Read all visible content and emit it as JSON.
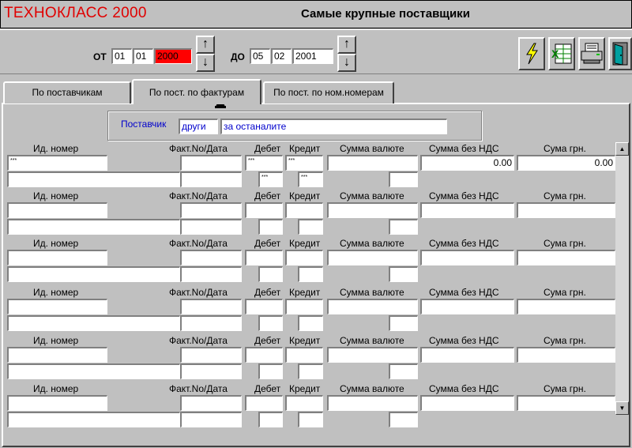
{
  "app": {
    "title": "ТЕХНОКЛАСС 2000",
    "window_title": "Самые крупные поставщики"
  },
  "date_from": {
    "label": "ОТ",
    "day": "01",
    "month": "01",
    "year": "2000"
  },
  "date_to": {
    "label": "ДО",
    "day": "05",
    "month": "02",
    "year": "2001"
  },
  "spinner": {
    "up": "↑",
    "down": "↓"
  },
  "toolbar": {
    "buttons": [
      {
        "name": "run",
        "icon": "lightning-icon"
      },
      {
        "name": "excel-export",
        "icon": "excel-icon"
      },
      {
        "name": "print",
        "icon": "printer-icon"
      },
      {
        "name": "exit",
        "icon": "exit-door-icon"
      }
    ]
  },
  "tabs": [
    {
      "label": "По поставчикам",
      "active": false
    },
    {
      "label": "По пост. по фактурам",
      "active": true
    },
    {
      "label": "По пост. по ном.номерам",
      "active": false
    }
  ],
  "supplier": {
    "label": "Поставчик",
    "code": "други",
    "name": "за останалите"
  },
  "columns": {
    "id": "Ид. номер",
    "invoice": "Факт.No/Дата",
    "debit": "Дебет",
    "credit": "Кредит",
    "currency_sum": "Сумма валюте",
    "sum_no_vat": "Сумма без НДС",
    "sum_uah": "Сума грн."
  },
  "first_row": {
    "id": "***",
    "debit": "***",
    "credit": "***",
    "debit2": "***",
    "credit2": "***",
    "sum_no_vat": "0.00",
    "sum_uah": "0.00"
  },
  "scrollbar": {
    "up": "▲",
    "down": "▼"
  }
}
